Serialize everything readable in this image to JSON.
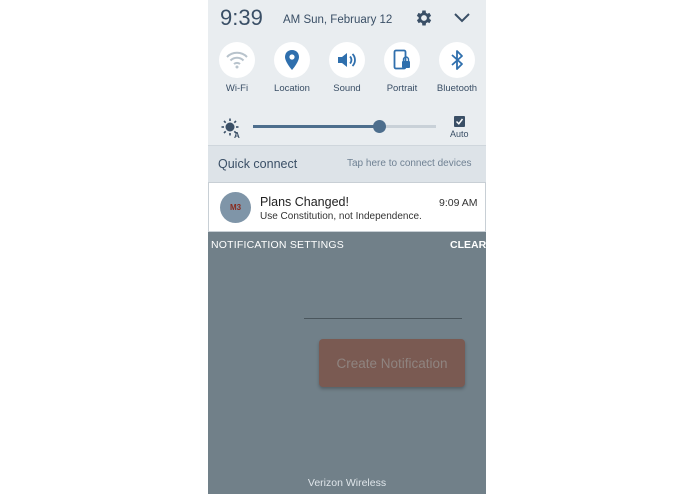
{
  "status": {
    "time": "9:39",
    "ampm_date": "AM  Sun, February 12"
  },
  "quick_tiles": [
    {
      "label": "Wi-Fi",
      "icon": "wifi-icon"
    },
    {
      "label": "Location",
      "icon": "location-pin-icon"
    },
    {
      "label": "Sound",
      "icon": "speaker-icon"
    },
    {
      "label": "Portrait",
      "icon": "portrait-lock-icon"
    },
    {
      "label": "Bluetooth",
      "icon": "bluetooth-icon"
    }
  ],
  "brightness": {
    "level": 0.69,
    "auto_label": "Auto",
    "auto_checked": true
  },
  "quick_connect": {
    "title": "Quick connect",
    "hint": "Tap here to connect devices"
  },
  "notification": {
    "title": "Plans Changed!",
    "time": "9:09 AM",
    "text": "Use Constitution, not Independence.",
    "avatar_text": "M3"
  },
  "actions": {
    "settings": "NOTIFICATION SETTINGS",
    "clear": "CLEAR"
  },
  "app": {
    "button": "Create Notification"
  },
  "footer": {
    "carrier": "Verizon Wireless"
  },
  "colors": {
    "accent": "#4d6e8d",
    "icon_blue": "#2f6fad",
    "shade_bg": "#718089"
  }
}
